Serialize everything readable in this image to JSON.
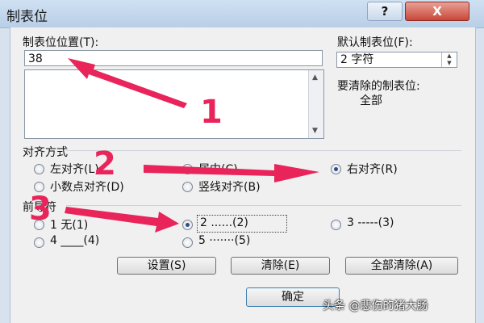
{
  "window": {
    "title": "制表位",
    "help": "?",
    "close": "X"
  },
  "tab_position": {
    "label": "制表位位置(T):",
    "value": "38"
  },
  "default_tab": {
    "label": "默认制表位(F):",
    "value": "2 字符"
  },
  "clear_info": {
    "label": "要清除的制表位:",
    "value": "全部"
  },
  "alignment": {
    "label": "对齐方式",
    "options": [
      {
        "label": "左对齐(L)"
      },
      {
        "label": "居中(C)"
      },
      {
        "label": "右对齐(R)"
      },
      {
        "label": "小数点对齐(D)"
      },
      {
        "label": "竖线对齐(B)"
      }
    ],
    "selected": "右对齐(R)"
  },
  "leader": {
    "label": "前导符",
    "options": [
      {
        "label": "1 无(1)"
      },
      {
        "label": "2 ......(2)"
      },
      {
        "label": "3 -----(3)"
      },
      {
        "label": "4 ____(4)"
      },
      {
        "label": "5 ·······(5)"
      }
    ],
    "selected": "2 ......(2)"
  },
  "buttons": {
    "set": "设置(S)",
    "clear": "清除(E)",
    "clear_all": "全部清除(A)",
    "ok": "确定"
  },
  "annotations": [
    "1",
    "2",
    "3"
  ],
  "watermark": "头条 @悲伤的猪大肠",
  "colors": {
    "arrow": "#e8245a",
    "title_bar": "#c5d8ee"
  }
}
